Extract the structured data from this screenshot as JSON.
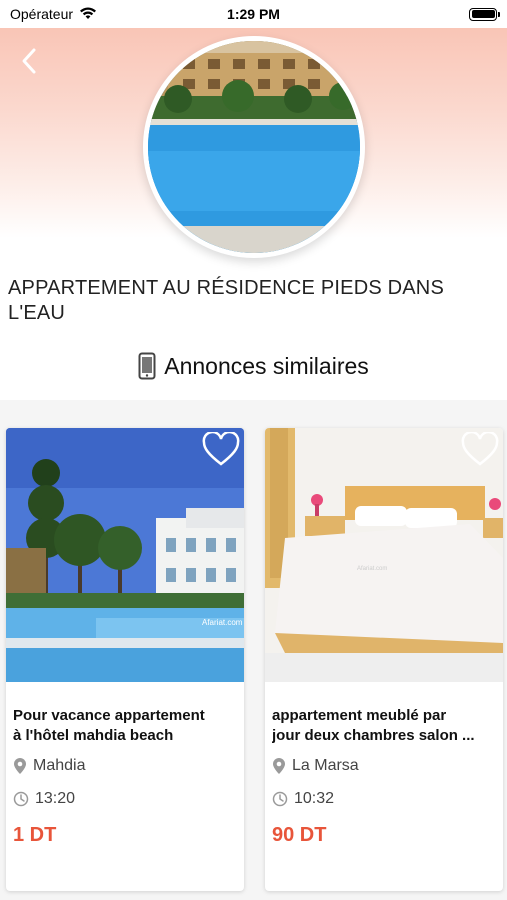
{
  "status_bar": {
    "carrier": "Opérateur",
    "time": "1:29 PM"
  },
  "header": {
    "icons": {
      "back": "chevron-left-icon"
    }
  },
  "listing": {
    "title_line1": "APPARTEMENT AU RÉSIDENCE PIEDS DANS",
    "title_line2": "L'EAU"
  },
  "similar": {
    "heading": "Annonces similaires",
    "icon": "phone-icon",
    "items": [
      {
        "title_line1": "Pour vacance appartement",
        "title_line2": "à l'hôtel mahdia beach",
        "location": "Mahdia",
        "time": "13:20",
        "price": "1 DT",
        "watermark": "Afariat.com"
      },
      {
        "title_line1": "appartement meublé par",
        "title_line2": "jour deux chambres salon ...",
        "location": "La Marsa",
        "time": "10:32",
        "price": "90 DT"
      }
    ]
  },
  "colors": {
    "accent_price": "#e8553a",
    "header_gradient_top": "#f9c5b6",
    "pool_blue": "#3aa4e4"
  }
}
